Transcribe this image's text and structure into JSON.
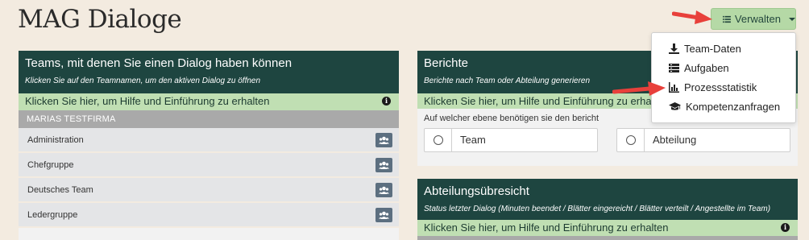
{
  "page": {
    "title": "MAG Dialoge"
  },
  "toolbar": {
    "manage_label": "Verwalten"
  },
  "menu": {
    "items": [
      {
        "label": "Team-Daten",
        "icon": "download-icon"
      },
      {
        "label": "Aufgaben",
        "icon": "tasks-icon"
      },
      {
        "label": "Prozessstatistik",
        "icon": "bar-chart-icon"
      },
      {
        "label": "Kompetenzanfragen",
        "icon": "graduation-cap-icon"
      }
    ]
  },
  "teams_panel": {
    "title": "Teams, mit denen Sie einen Dialog haben können",
    "subtitle": "Klicken Sie auf den Teamnamen, um den aktiven Dialog zu öffnen",
    "help": "Klicken Sie hier, um Hilfe und Einführung zu erhalten",
    "company": "MARIAS TESTFIRMA",
    "teams": [
      "Administration",
      "Chefgruppe",
      "Deutsches Team",
      "Ledergruppe"
    ]
  },
  "reports_panel": {
    "title": "Berichte",
    "subtitle": "Berichte nach Team oder Abteilung generieren",
    "help": "Klicken Sie hier, um Hilfe und Einführung zu erhalten",
    "question": "Auf welcher ebene benötigen sie den bericht",
    "options": [
      "Team",
      "Abteilung"
    ]
  },
  "department_panel": {
    "title": "Abteilungsübresicht",
    "subtitle": "Status letzter Dialog (Minuten beendet / Blätter eingereicht / Blätter verteilt / Angestellte im Team)",
    "help": "Klicken Sie hier, um Hilfe und Einführung zu erhalten"
  },
  "colors": {
    "header": "#1e4540",
    "help_bar": "#c0dfb3",
    "accent_button": "#b5d9a6",
    "arrow": "#e8403b",
    "background": "#f3ebe0"
  }
}
